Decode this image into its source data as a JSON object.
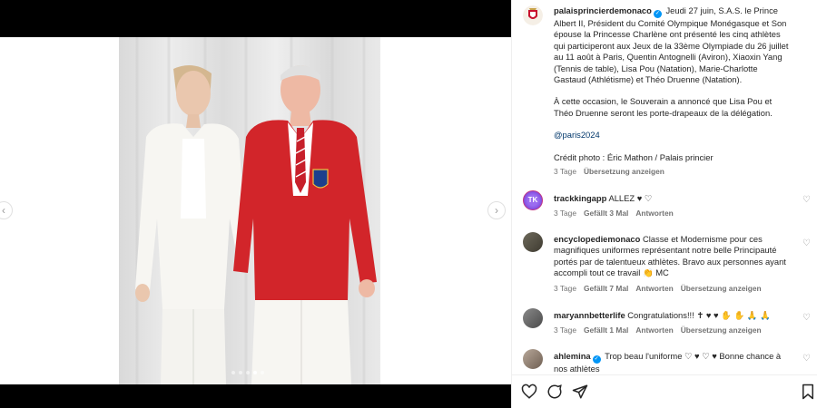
{
  "post": {
    "username": "palaisprincierdemonaco",
    "caption_p1": "Jeudi 27 juin, S.A.S. le Prince Albert II, Président du Comité Olympique Monégasque et Son épouse la Princesse Charlène ont présenté les cinq athlètes qui participeront aux Jeux de la 33ème Olympiade du 26 juillet au 11 août à Paris, Quentin Antognelli (Aviron), Xiaoxin Yang (Tennis de table), Lisa Pou (Natation), Marie-Charlotte Gastaud (Athlétisme) et Théo Druenne (Natation).",
    "caption_p2": "À cette occasion, le Souverain a annoncé que Lisa Pou et Théo Druenne seront les porte-drapeaux de la délégation.",
    "hashtag": "@paris2024",
    "credit": "Crédit photo : Éric Mathon / Palais princier",
    "time": "3 Tage",
    "translate": "Übersetzung anzeigen"
  },
  "comments": [
    {
      "username": "trackkingapp",
      "avatar_text": "TK",
      "text": "ALLEZ ♥ ♡",
      "time": "3 Tage",
      "likes": "Gefällt 3 Mal",
      "reply": "Antworten",
      "translate": ""
    },
    {
      "username": "encyclopediemonaco",
      "avatar_text": "",
      "text": "Classe et Modernisme pour ces magnifiques uniformes représentant notre belle Principauté portés par de talentueux athlètes. Bravo aux personnes ayant accompli tout ce travail 👏 MC",
      "time": "3 Tage",
      "likes": "Gefällt 7 Mal",
      "reply": "Antworten",
      "translate": "Übersetzung anzeigen"
    },
    {
      "username": "maryannbetterlife",
      "avatar_text": "",
      "text": "Congratulations!!! ✝ ♥ ♥ ✋ ✋ 🙏 🙏",
      "time": "3 Tage",
      "likes": "Gefällt 1 Mal",
      "reply": "Antworten",
      "translate": "Übersetzung anzeigen"
    },
    {
      "username": "ahlemina",
      "avatar_text": "",
      "text": "Trop beau l'uniforme ♡ ♥ ♡ ♥ Bonne chance à nos athlètes",
      "time": "",
      "likes": "",
      "reply": "",
      "translate": ""
    }
  ],
  "icons": {
    "like": "heart-icon",
    "comment": "comment-icon",
    "share": "share-icon",
    "save": "bookmark-icon"
  },
  "colors": {
    "link": "#00376b",
    "muted": "#737373",
    "verified": "#0095f6",
    "jacket": "#d2252a"
  }
}
